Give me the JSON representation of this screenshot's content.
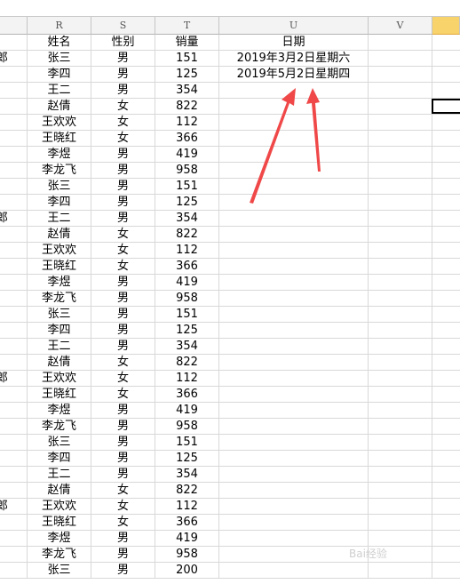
{
  "columns": [
    "R",
    "S",
    "T",
    "U",
    "V"
  ],
  "header_row": {
    "name": "姓名",
    "gender": "性别",
    "sales": "销量",
    "date": "日期"
  },
  "dates": [
    "2019年3月2日星期六",
    "2019年5月2日星期四"
  ],
  "rows": [
    {
      "q": "郎",
      "name": "张三",
      "gender": "男",
      "sales": "151"
    },
    {
      "q": "",
      "name": "李四",
      "gender": "男",
      "sales": "125"
    },
    {
      "q": "",
      "name": "王二",
      "gender": "男",
      "sales": "354"
    },
    {
      "q": "",
      "name": "赵倩",
      "gender": "女",
      "sales": "822"
    },
    {
      "q": "",
      "name": "王欢欢",
      "gender": "女",
      "sales": "112"
    },
    {
      "q": "",
      "name": "王晓红",
      "gender": "女",
      "sales": "366"
    },
    {
      "q": "",
      "name": "李煜",
      "gender": "男",
      "sales": "419"
    },
    {
      "q": "",
      "name": "李龙飞",
      "gender": "男",
      "sales": "958"
    },
    {
      "q": "",
      "name": "张三",
      "gender": "男",
      "sales": "151"
    },
    {
      "q": "",
      "name": "李四",
      "gender": "男",
      "sales": "125"
    },
    {
      "q": "郎",
      "name": "王二",
      "gender": "男",
      "sales": "354"
    },
    {
      "q": "",
      "name": "赵倩",
      "gender": "女",
      "sales": "822"
    },
    {
      "q": "",
      "name": "王欢欢",
      "gender": "女",
      "sales": "112"
    },
    {
      "q": "",
      "name": "王晓红",
      "gender": "女",
      "sales": "366"
    },
    {
      "q": "",
      "name": "李煜",
      "gender": "男",
      "sales": "419"
    },
    {
      "q": "",
      "name": "李龙飞",
      "gender": "男",
      "sales": "958"
    },
    {
      "q": "",
      "name": "张三",
      "gender": "男",
      "sales": "151"
    },
    {
      "q": "",
      "name": "李四",
      "gender": "男",
      "sales": "125"
    },
    {
      "q": "",
      "name": "王二",
      "gender": "男",
      "sales": "354"
    },
    {
      "q": "",
      "name": "赵倩",
      "gender": "女",
      "sales": "822"
    },
    {
      "q": "郎",
      "name": "王欢欢",
      "gender": "女",
      "sales": "112"
    },
    {
      "q": "",
      "name": "王晓红",
      "gender": "女",
      "sales": "366"
    },
    {
      "q": "",
      "name": "李煜",
      "gender": "男",
      "sales": "419"
    },
    {
      "q": "",
      "name": "李龙飞",
      "gender": "男",
      "sales": "958"
    },
    {
      "q": "",
      "name": "张三",
      "gender": "男",
      "sales": "151"
    },
    {
      "q": "",
      "name": "李四",
      "gender": "男",
      "sales": "125"
    },
    {
      "q": "",
      "name": "王二",
      "gender": "男",
      "sales": "354"
    },
    {
      "q": "",
      "name": "赵倩",
      "gender": "女",
      "sales": "822"
    },
    {
      "q": "郎",
      "name": "王欢欢",
      "gender": "女",
      "sales": "112"
    },
    {
      "q": "",
      "name": "王晓红",
      "gender": "女",
      "sales": "366"
    },
    {
      "q": "",
      "name": "李煜",
      "gender": "男",
      "sales": "419"
    },
    {
      "q": "",
      "name": "李龙飞",
      "gender": "男",
      "sales": "958"
    },
    {
      "q": "",
      "name": "张三",
      "gender": "男",
      "sales": "200"
    }
  ],
  "colors": {
    "arrow": "#f04848",
    "selected_header": "#f8d26b"
  },
  "watermark": {
    "text": "Bai",
    "suffix": "经验"
  }
}
